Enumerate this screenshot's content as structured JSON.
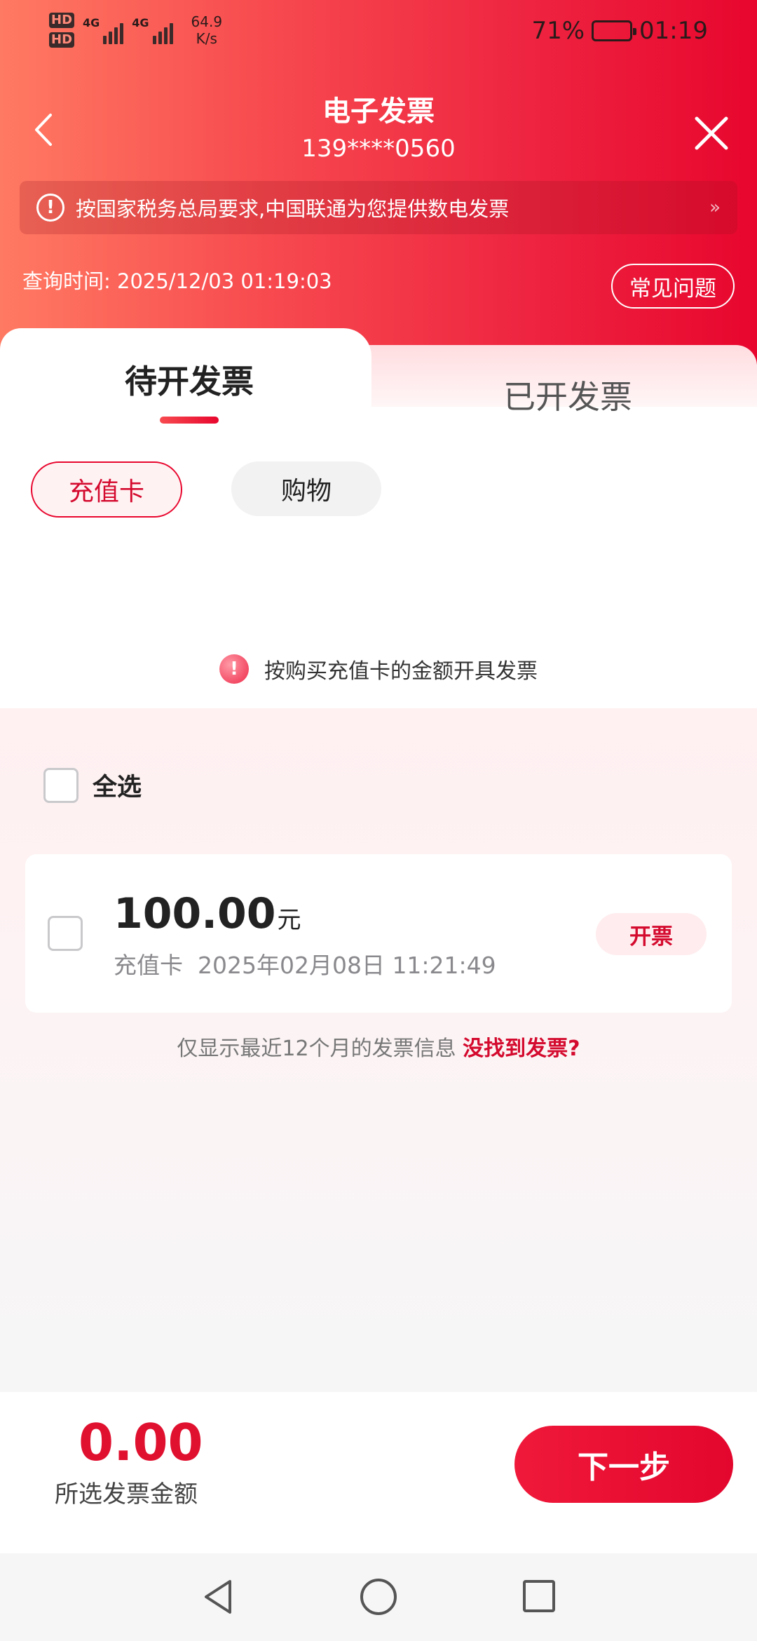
{
  "status_bar": {
    "hd1": "HD",
    "hd2": "HD",
    "net1": "4G",
    "net2": "4G",
    "speed_value": "64.9",
    "speed_unit": "K/s",
    "battery": "71%",
    "battery_level": 0.71,
    "time": "01:19"
  },
  "header": {
    "title": "电子发票",
    "phone": "139****0560",
    "notice": "按国家税务总局要求,中国联通为您提供数电发票",
    "notice_more": "»",
    "query_label": "查询时间:",
    "query_time": "2025/12/03 01:19:03",
    "faq": "常见问题"
  },
  "tabs": {
    "pending": "待开发票",
    "issued": "已开发票"
  },
  "chips": {
    "recharge": "充值卡",
    "shopping": "购物"
  },
  "tip": {
    "icon": "!",
    "text": "按购买充值卡的金额开具发票"
  },
  "list": {
    "select_all": "全选",
    "items": [
      {
        "amount": "100.00",
        "unit": "元",
        "type": "充值卡",
        "date": "2025年02月08日 11:21:49",
        "action": "开票"
      }
    ],
    "hint": "仅显示最近12个月的发票信息",
    "hint_link": "没找到发票?"
  },
  "footer": {
    "total": "0.00",
    "total_label": "所选发票金额",
    "next": "下一步"
  },
  "colors": {
    "brand": "#e8062e",
    "brand_light": "#ff7a62"
  }
}
